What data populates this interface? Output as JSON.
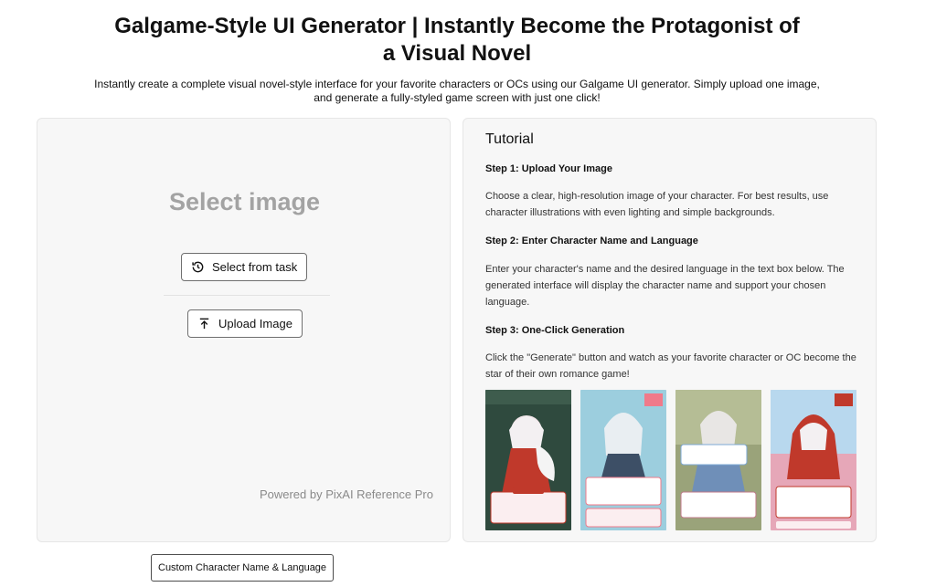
{
  "page": {
    "title": "Galgame-Style UI Generator | Instantly Become the Protagonist of a Visual Novel",
    "subtitle": "Instantly create a complete visual novel-style interface for your favorite characters or OCs using our Galgame UI generator. Simply upload one image, and generate a fully-styled game screen with just one click!"
  },
  "upload": {
    "heading": "Select image",
    "select_task_label": "Select from task",
    "upload_label": "Upload Image",
    "powered_by": "Powered by PixAI Reference Pro",
    "custom_button_label": "Custom Character Name & Language"
  },
  "tutorial": {
    "title": "Tutorial",
    "steps": [
      {
        "heading": "Step 1: Upload Your Image",
        "text": "Choose a clear, high-resolution image of your character. For best results, use character illustrations with even lighting and simple backgrounds."
      },
      {
        "heading": "Step 2: Enter Character Name and Language",
        "text": "Enter your character's name and the desired language in the text box below. The generated interface will display the character name and support your chosen language."
      },
      {
        "heading": "Step 3: One-Click Generation",
        "text": "Click the \"Generate\" button and watch as your favorite character or OC become the star of their own romance game!"
      }
    ],
    "examples": [
      {
        "alt": "example-1",
        "bg": "#2f4a3e",
        "accent": "#c0392b"
      },
      {
        "alt": "example-2",
        "bg": "#8fc6d8",
        "accent": "#f07a8a"
      },
      {
        "alt": "example-3",
        "bg": "#9aa37a",
        "accent": "#7da8d6"
      },
      {
        "alt": "example-4",
        "bg": "#e6a7b8",
        "accent": "#c0392b"
      }
    ]
  },
  "colors": {
    "panel_bg": "#f7f7f7",
    "muted_heading": "#a3a3a3"
  }
}
